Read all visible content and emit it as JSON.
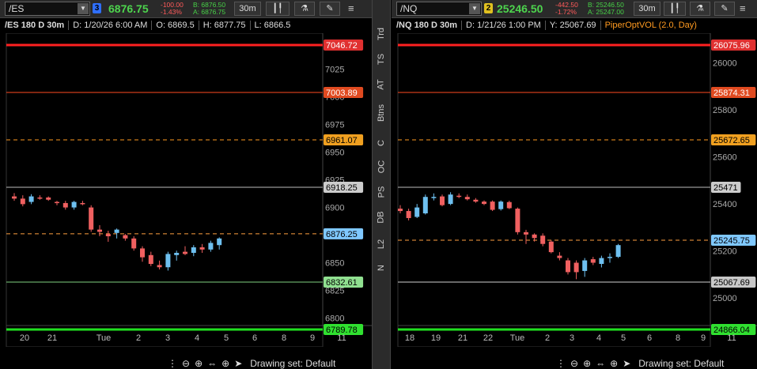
{
  "left": {
    "symbol": "/ES",
    "link_num": "3",
    "link_color": "#2f6fff",
    "last": "6876.75",
    "change": "-100.00",
    "change_pct": "-1.43%",
    "bid": "B: 6876.50",
    "ask": "A: 6876.75",
    "interval_btn": "30m",
    "header": {
      "title": "/ES 180 D 30m",
      "date": "D: 1/20/26 6:00 AM",
      "open": "O: 6869.5",
      "high": "H: 6877.75",
      "low": "L: 6866.5"
    },
    "y_ticks": [
      "7025",
      "7000",
      "6975",
      "6950",
      "6925",
      "6900",
      "6875",
      "6850",
      "6825",
      "6800"
    ],
    "levels": [
      {
        "label": "7046.72",
        "color": "#ff2020",
        "style": "solid",
        "bg": "#e03030",
        "fg": "#fff"
      },
      {
        "label": "7003.89",
        "color": "#ff4a20",
        "style": "solid",
        "bg": "#e04a20",
        "fg": "#fff"
      },
      {
        "label": "6961.07",
        "color": "#ff9a20",
        "style": "dashed",
        "bg": "#f0a020",
        "fg": "#000"
      },
      {
        "label": "6918.25",
        "color": "#bbbbbb",
        "style": "solid",
        "bg": "#cccccc",
        "fg": "#000"
      },
      {
        "label": "6876.25",
        "color": "#ffa040",
        "style": "dashed",
        "bg": "#7fc8ff",
        "fg": "#000"
      },
      {
        "label": "6832.61",
        "color": "#7fd07f",
        "style": "solid",
        "bg": "#90e090",
        "fg": "#000"
      },
      {
        "label": "6789.78",
        "color": "#20e020",
        "style": "solid",
        "bg": "#30e030",
        "fg": "#000"
      }
    ],
    "x_labels": [
      "20",
      "21",
      "Tue",
      "2",
      "3",
      "4",
      "5",
      "6",
      "8",
      "9",
      "11"
    ],
    "candles": [
      {
        "o": 6910,
        "h": 6913,
        "l": 6906,
        "c": 6908
      },
      {
        "o": 6908,
        "h": 6911,
        "l": 6901,
        "c": 6903
      },
      {
        "o": 6905,
        "h": 6912,
        "l": 6903,
        "c": 6910
      },
      {
        "o": 6909,
        "h": 6911,
        "l": 6907,
        "c": 6908
      },
      {
        "o": 6909,
        "h": 6910,
        "l": 6906,
        "c": 6907
      },
      {
        "o": 6905,
        "h": 6906,
        "l": 6902,
        "c": 6904
      },
      {
        "o": 6904,
        "h": 6906,
        "l": 6898,
        "c": 6900
      },
      {
        "o": 6900,
        "h": 6906,
        "l": 6898,
        "c": 6905
      },
      {
        "o": 6904,
        "h": 6906,
        "l": 6902,
        "c": 6903
      },
      {
        "o": 6900,
        "h": 6902,
        "l": 6878,
        "c": 6880
      },
      {
        "o": 6880,
        "h": 6884,
        "l": 6874,
        "c": 6878
      },
      {
        "o": 6876,
        "h": 6879,
        "l": 6869,
        "c": 6874
      },
      {
        "o": 6877,
        "h": 6881,
        "l": 6872,
        "c": 6880
      },
      {
        "o": 6875,
        "h": 6876,
        "l": 6870,
        "c": 6872
      },
      {
        "o": 6872,
        "h": 6874,
        "l": 6861,
        "c": 6863
      },
      {
        "o": 6863,
        "h": 6865,
        "l": 6851,
        "c": 6855
      },
      {
        "o": 6857,
        "h": 6860,
        "l": 6847,
        "c": 6849
      },
      {
        "o": 6848,
        "h": 6852,
        "l": 6844,
        "c": 6846
      },
      {
        "o": 6846,
        "h": 6860,
        "l": 6843,
        "c": 6858
      },
      {
        "o": 6857,
        "h": 6861,
        "l": 6852,
        "c": 6859
      },
      {
        "o": 6860,
        "h": 6865,
        "l": 6857,
        "c": 6858
      },
      {
        "o": 6859,
        "h": 6866,
        "l": 6856,
        "c": 6864
      },
      {
        "o": 6864,
        "h": 6867,
        "l": 6859,
        "c": 6862
      },
      {
        "o": 6862,
        "h": 6870,
        "l": 6860,
        "c": 6868
      },
      {
        "o": 6866,
        "h": 6873,
        "l": 6862,
        "c": 6872
      }
    ]
  },
  "right": {
    "symbol": "/NQ",
    "link_num": "2",
    "link_color": "#e0c020",
    "last": "25246.50",
    "change": "-442.50",
    "change_pct": "-1.72%",
    "bid": "B: 25246.50",
    "ask": "A: 25247.00",
    "interval_btn": "30m",
    "header": {
      "title": "/NQ 180 D 30m",
      "date": "D: 1/21/26 1:00 PM",
      "y": "Y: 25067.69",
      "study": "PiperOptVOL (2.0, Day)"
    },
    "y_ticks": [
      "26000",
      "25800",
      "25600",
      "25400",
      "25200",
      "25000"
    ],
    "levels": [
      {
        "label": "26075.96",
        "color": "#ff2020",
        "style": "solid",
        "bg": "#e03030",
        "fg": "#fff"
      },
      {
        "label": "25874.31",
        "color": "#ff4a20",
        "style": "solid",
        "bg": "#e04a20",
        "fg": "#fff"
      },
      {
        "label": "25672.65",
        "color": "#ff9a20",
        "style": "dashed",
        "bg": "#f0a020",
        "fg": "#000"
      },
      {
        "label": "25471",
        "color": "#bbbbbb",
        "style": "solid",
        "bg": "#cccccc",
        "fg": "#000"
      },
      {
        "label": "25245.75",
        "color": "#ffa040",
        "style": "dashed",
        "bg": "#7fc8ff",
        "fg": "#000"
      },
      {
        "label": "25067.69",
        "color": "#d0d0d0",
        "style": "solid",
        "bg": "#c8c8c8",
        "fg": "#000"
      },
      {
        "label": "24866.04",
        "color": "#20e020",
        "style": "solid",
        "bg": "#30e030",
        "fg": "#000"
      }
    ],
    "x_labels": [
      "18",
      "19",
      "21",
      "22",
      "Tue",
      "2",
      "3",
      "4",
      "5",
      "6",
      "8",
      "9",
      "11"
    ],
    "candles": [
      {
        "o": 25380,
        "h": 25395,
        "l": 25360,
        "c": 25370
      },
      {
        "o": 25370,
        "h": 25380,
        "l": 25330,
        "c": 25340
      },
      {
        "o": 25345,
        "h": 25400,
        "l": 25340,
        "c": 25385
      },
      {
        "o": 25360,
        "h": 25440,
        "l": 25355,
        "c": 25430
      },
      {
        "o": 25425,
        "h": 25445,
        "l": 25415,
        "c": 25430
      },
      {
        "o": 25432,
        "h": 25440,
        "l": 25390,
        "c": 25395
      },
      {
        "o": 25400,
        "h": 25450,
        "l": 25395,
        "c": 25440
      },
      {
        "o": 25435,
        "h": 25445,
        "l": 25425,
        "c": 25430
      },
      {
        "o": 25430,
        "h": 25440,
        "l": 25415,
        "c": 25420
      },
      {
        "o": 25418,
        "h": 25425,
        "l": 25405,
        "c": 25410
      },
      {
        "o": 25410,
        "h": 25415,
        "l": 25395,
        "c": 25400
      },
      {
        "o": 25410,
        "h": 25415,
        "l": 25370,
        "c": 25375
      },
      {
        "o": 25378,
        "h": 25415,
        "l": 25372,
        "c": 25410
      },
      {
        "o": 25408,
        "h": 25414,
        "l": 25378,
        "c": 25382
      },
      {
        "o": 25380,
        "h": 25385,
        "l": 25270,
        "c": 25280
      },
      {
        "o": 25280,
        "h": 25290,
        "l": 25230,
        "c": 25270
      },
      {
        "o": 25270,
        "h": 25275,
        "l": 25240,
        "c": 25255
      },
      {
        "o": 25265,
        "h": 25275,
        "l": 25220,
        "c": 25230
      },
      {
        "o": 25240,
        "h": 25245,
        "l": 25190,
        "c": 25195
      },
      {
        "o": 25180,
        "h": 25195,
        "l": 25160,
        "c": 25170
      },
      {
        "o": 25160,
        "h": 25170,
        "l": 25100,
        "c": 25110
      },
      {
        "o": 25150,
        "h": 25160,
        "l": 25080,
        "c": 25110
      },
      {
        "o": 25115,
        "h": 25170,
        "l": 25090,
        "c": 25160
      },
      {
        "o": 25165,
        "h": 25175,
        "l": 25140,
        "c": 25150
      },
      {
        "o": 25145,
        "h": 25180,
        "l": 25130,
        "c": 25170
      },
      {
        "o": 25170,
        "h": 25190,
        "l": 25150,
        "c": 25175
      },
      {
        "o": 25175,
        "h": 25230,
        "l": 25170,
        "c": 25225
      }
    ]
  },
  "sidebar": {
    "items": [
      "Trd",
      "TS",
      "AT",
      "Btns",
      "C",
      "OC",
      "PS",
      "DB",
      "L2",
      "N"
    ]
  },
  "bottom": {
    "drawing_set": "Drawing set: Default"
  },
  "colors": {
    "up": "#6ec0f0",
    "down": "#f06060"
  }
}
